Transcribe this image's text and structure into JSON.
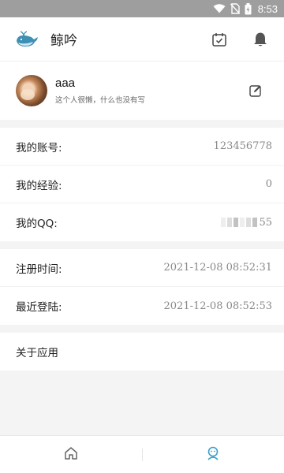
{
  "status_bar": {
    "time": "8:53",
    "icons": [
      "wifi-icon",
      "no-sim-icon",
      "battery-icon"
    ]
  },
  "app_bar": {
    "title": "鲸吟",
    "icons": [
      "whale-logo-icon",
      "calendar-check-icon",
      "bell-icon"
    ]
  },
  "profile": {
    "name": "aaa",
    "bio": "这个人很懒，什么也没有写",
    "edit_icon": "edit-icon"
  },
  "account": {
    "items": [
      {
        "label": "我的账号:",
        "value": "123456778"
      },
      {
        "label": "我的经验:",
        "value": "0"
      },
      {
        "label": "我的QQ:",
        "value_suffix": "55"
      }
    ]
  },
  "times": {
    "items": [
      {
        "label": "注册时间:",
        "value": "2021-12-08 08:52:31"
      },
      {
        "label": "最近登陆:",
        "value": "2021-12-08 08:52:53"
      }
    ]
  },
  "about": {
    "label": "关于应用"
  },
  "bottom_nav": {
    "items": [
      "home-icon",
      "profile-icon"
    ],
    "active_color": "#3aa0c8",
    "inactive_color": "#666666"
  },
  "colors": {
    "accent": "#3aa0c8",
    "status_bar": "#9e9e9e"
  }
}
